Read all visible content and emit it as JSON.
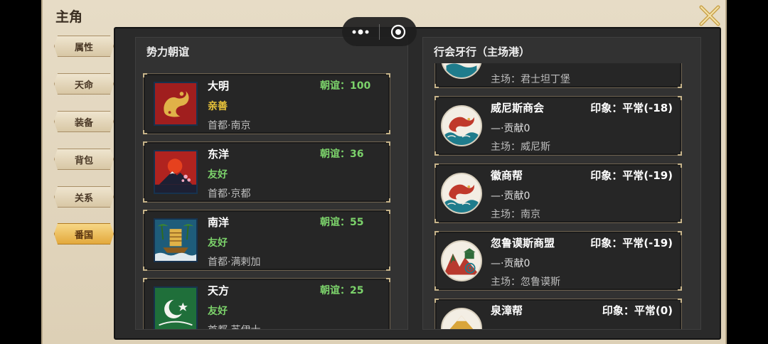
{
  "window": {
    "title": "主角"
  },
  "tabs": [
    {
      "label": "属性",
      "active": false
    },
    {
      "label": "天命",
      "active": false
    },
    {
      "label": "装备",
      "active": false
    },
    {
      "label": "背包",
      "active": false
    },
    {
      "label": "关系",
      "active": false
    },
    {
      "label": "番国",
      "active": true
    }
  ],
  "capsule": {
    "more_glyph": "•●•"
  },
  "left_panel": {
    "title": "势力朝谊",
    "factions": [
      {
        "name": "大明",
        "relation": "朝谊：100",
        "status": "亲善",
        "status_color": "#e7c23a",
        "capital": "首都·南京",
        "flag": "dragon-flag-icon"
      },
      {
        "name": "东洋",
        "relation": "朝谊：36",
        "status": "友好",
        "status_color": "#7cd36b",
        "capital": "首都·京都",
        "flag": "rising-sun-flag-icon"
      },
      {
        "name": "南洋",
        "relation": "朝谊：55",
        "status": "友好",
        "status_color": "#7cd36b",
        "capital": "首都·满剌加",
        "flag": "junk-ship-flag-icon"
      },
      {
        "name": "天方",
        "relation": "朝谊：25",
        "status": "友好",
        "status_color": "#7cd36b",
        "capital": "首都·苏伊士",
        "flag": "crescent-flag-icon"
      }
    ]
  },
  "right_panel": {
    "title": "行会牙行（主场港）",
    "guilds": [
      {
        "name": "",
        "impression": "",
        "contribution": "",
        "home": "主场：君士坦丁堡",
        "emblem": "ship-emblem-icon"
      },
      {
        "name": "威尼斯商会",
        "impression": "印象：平常(-18)",
        "contribution": "—·贡献0",
        "home": "主场：威尼斯",
        "emblem": "dragon-wave-emblem-icon"
      },
      {
        "name": "徽商帮",
        "impression": "印象：平常(-19)",
        "contribution": "—·贡献0",
        "home": "主场：南京",
        "emblem": "dragon-wave-emblem-icon"
      },
      {
        "name": "忽鲁谟斯商盟",
        "impression": "印象：平常(-19)",
        "contribution": "—·贡献0",
        "home": "主场：忽鲁谟斯",
        "emblem": "mountain-pavilion-emblem-icon"
      },
      {
        "name": "泉漳帮",
        "impression": "印象：平常(0)",
        "contribution": "",
        "home": "",
        "emblem": "mountain-emblem-icon"
      }
    ]
  }
}
